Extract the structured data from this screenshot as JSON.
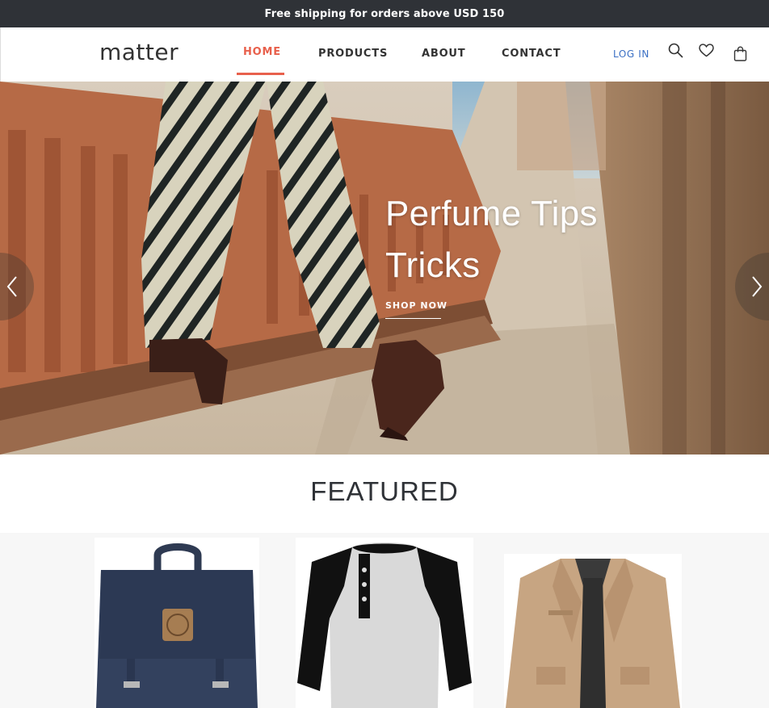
{
  "announcement": "Free shipping for orders above USD 150",
  "brand": {
    "logo": "matter"
  },
  "nav": {
    "items": [
      {
        "label": "HOME",
        "active": true
      },
      {
        "label": "PRODUCTS",
        "active": false
      },
      {
        "label": "ABOUT",
        "active": false
      },
      {
        "label": "CONTACT",
        "active": false
      }
    ],
    "login": "LOG IN",
    "icons": [
      "search-icon",
      "heart-icon",
      "shopping-bag-icon"
    ]
  },
  "hero": {
    "title_line1": "Perfume Tips",
    "title_line2": "Tricks",
    "cta": "SHOP NOW",
    "arrows": [
      "chevron-left-icon",
      "chevron-right-icon"
    ]
  },
  "featured": {
    "title": "FEATURED",
    "products": [
      {
        "name": "backpack"
      },
      {
        "name": "raglan-henley-shirt"
      },
      {
        "name": "khaki-jacket"
      }
    ]
  },
  "colors": {
    "accent": "#e8604c",
    "topbar": "#2f3237",
    "login": "#3a6fc4"
  }
}
